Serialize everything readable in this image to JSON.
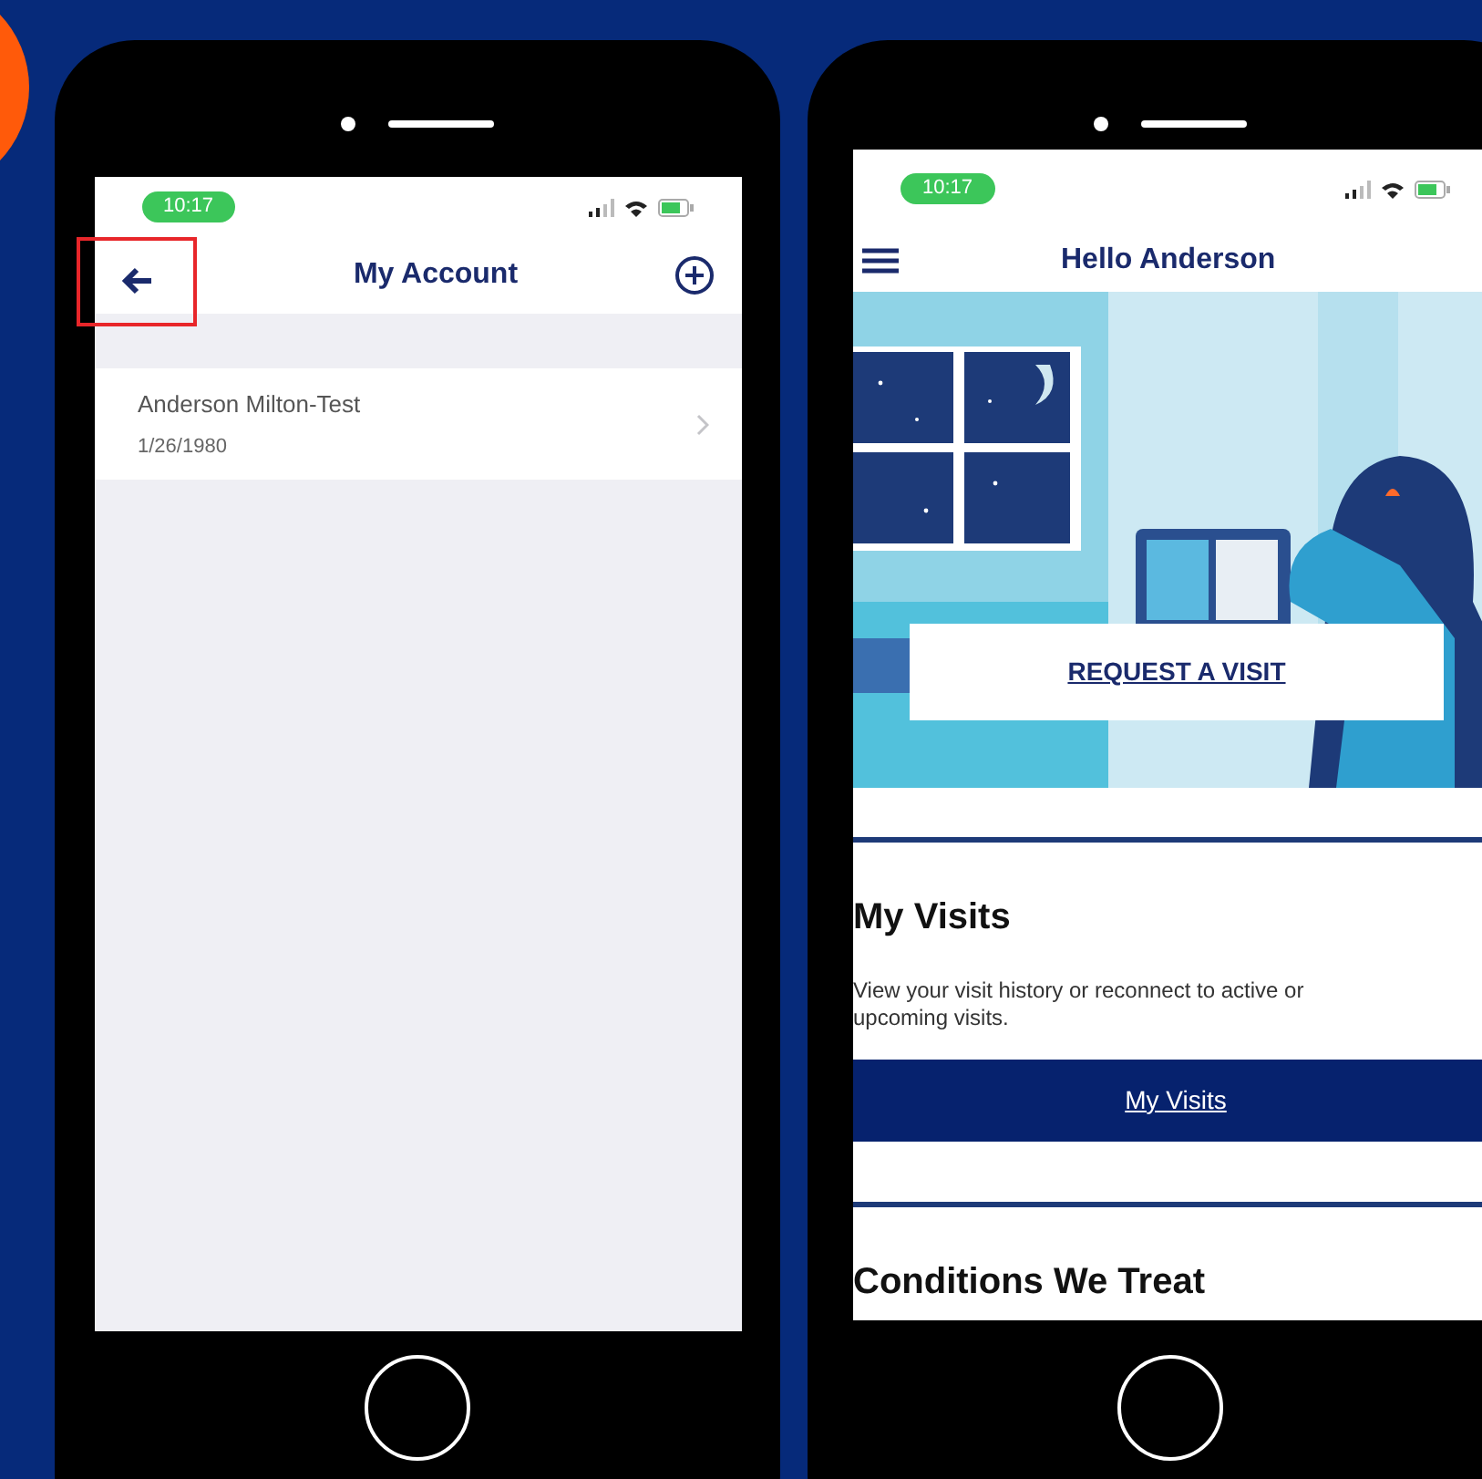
{
  "left_phone": {
    "status_bar": {
      "time": "10:17"
    },
    "header": {
      "title": "My Account",
      "back_highlighted": true
    },
    "accounts": [
      {
        "name": "Anderson Milton-Test",
        "date": "1/26/1980"
      }
    ]
  },
  "right_phone": {
    "status_bar": {
      "time": "10:17"
    },
    "header": {
      "title": "Hello Anderson"
    },
    "hero": {
      "button": "REQUEST A VISIT"
    },
    "sections": [
      {
        "title": "My Visits",
        "description": "View your visit history or reconnect to active or upcoming visits.",
        "button": "My Visits"
      },
      {
        "title": "Conditions We Treat"
      }
    ]
  }
}
